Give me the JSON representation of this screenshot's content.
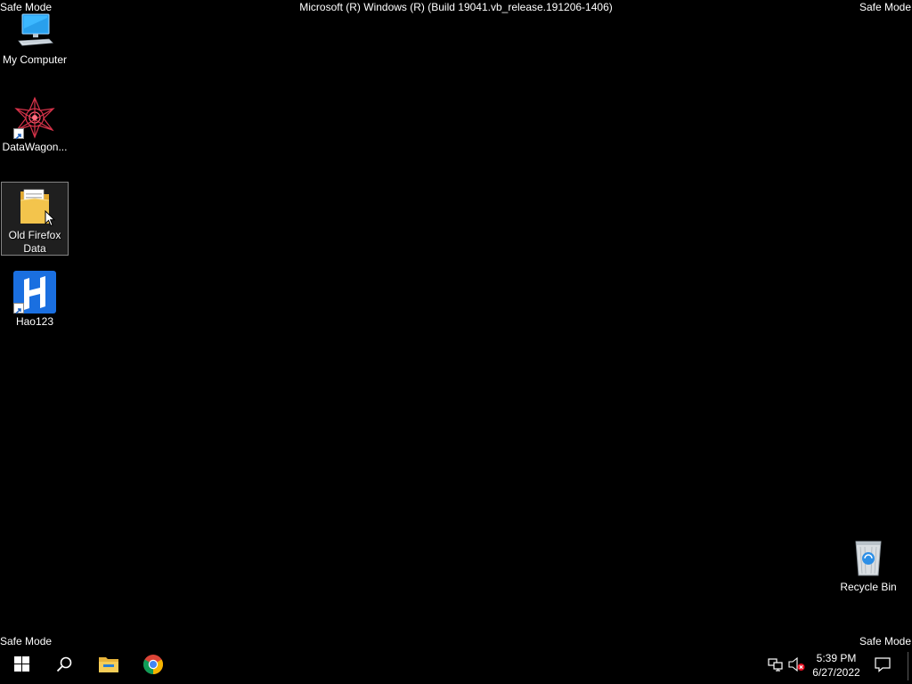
{
  "overlay": {
    "safe_mode": "Safe Mode",
    "build": "Microsoft (R) Windows (R) (Build 19041.vb_release.191206-1406)"
  },
  "desktop_icons": [
    {
      "label": "My Computer",
      "icon": "computer-icon"
    },
    {
      "label": "DataWagon...",
      "icon": "datawagon-icon"
    },
    {
      "label": "Old Firefox Data",
      "icon": "folder-icon"
    },
    {
      "label": "Hao123",
      "icon": "hao123-icon"
    },
    {
      "label": "Recycle Bin",
      "icon": "recycle-bin-icon"
    }
  ],
  "taskbar": {
    "pinned": [
      {
        "name": "start",
        "icon": "windows-logo-icon"
      },
      {
        "name": "search",
        "icon": "search-icon"
      },
      {
        "name": "file-explorer",
        "icon": "file-explorer-icon"
      },
      {
        "name": "chrome",
        "icon": "chrome-icon"
      }
    ],
    "tray": {
      "network_icon": "network-icon",
      "volume_icon": "volume-muted-icon",
      "notification_icon": "action-center-icon"
    },
    "clock": {
      "time": "5:39 PM",
      "date": "6/27/2022"
    }
  },
  "colors": {
    "background": "#000000",
    "taskbar": "#000000",
    "selection_border": "#8c8c8c",
    "hao123_blue": "#1a6fe0",
    "folder_yellow": "#f3c44c"
  }
}
